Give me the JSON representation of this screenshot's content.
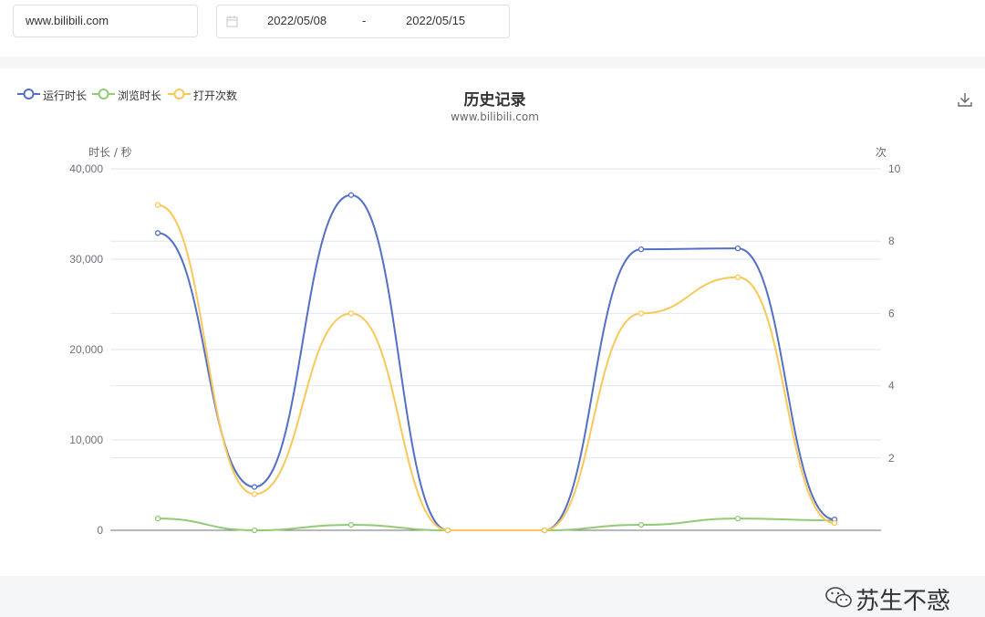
{
  "search": {
    "url_value": "www.bilibili.com"
  },
  "date_range": {
    "start": "2022/05/08",
    "separator": "-",
    "end": "2022/05/15"
  },
  "watermark": {
    "text": "苏生不惑"
  },
  "chart_data": {
    "type": "line",
    "title": "历史记录",
    "subtitle": "www.bilibili.com",
    "y_left_label": "时长 / 秒",
    "y_right_label": "次",
    "y_left_ticks": [
      "40,000",
      "30,000",
      "20,000",
      "10,000",
      "0"
    ],
    "y_right_ticks": [
      "10",
      "8",
      "6",
      "4",
      "2"
    ],
    "ylim_left": [
      0,
      40000
    ],
    "ylim_right": [
      0,
      10
    ],
    "smooth": true,
    "grid": true,
    "legend_position": "top-left",
    "x": [
      0,
      1,
      2,
      3,
      4,
      5,
      6,
      7
    ],
    "series": [
      {
        "name": "运行时长",
        "axis": "left",
        "color": "#5470c6",
        "values": [
          32900,
          4800,
          37100,
          0,
          0,
          31100,
          31200,
          1200
        ]
      },
      {
        "name": "浏览时长",
        "axis": "left",
        "color": "#91cc75",
        "values": [
          1300,
          0,
          600,
          0,
          0,
          600,
          1300,
          1100
        ]
      },
      {
        "name": "打开次数",
        "axis": "right",
        "color": "#fac858",
        "values": [
          9,
          1,
          6,
          0,
          0,
          6,
          7,
          0.2
        ]
      }
    ]
  }
}
